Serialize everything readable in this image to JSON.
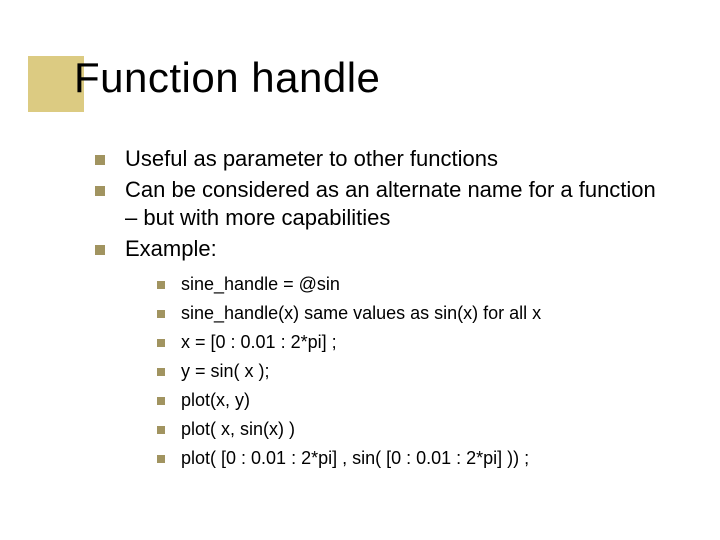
{
  "title": "Function handle",
  "bullets": {
    "b0": "Useful as parameter to other functions",
    "b1": "Can be considered as an alternate name for a function – but with more capabilities",
    "b2": "Example:"
  },
  "example": {
    "e0": "sine_handle = @sin",
    "e1": "sine_handle(x)   same values as sin(x)  for all x",
    "e2": "x = [0 : 0.01 : 2*pi] ;",
    "e3": "y = sin( x );",
    "e4": "plot(x, y)",
    "e5": "plot( x, sin(x) )",
    "e6": "plot( [0 : 0.01 : 2*pi] , sin( [0 : 0.01 : 2*pi] )) ;"
  }
}
